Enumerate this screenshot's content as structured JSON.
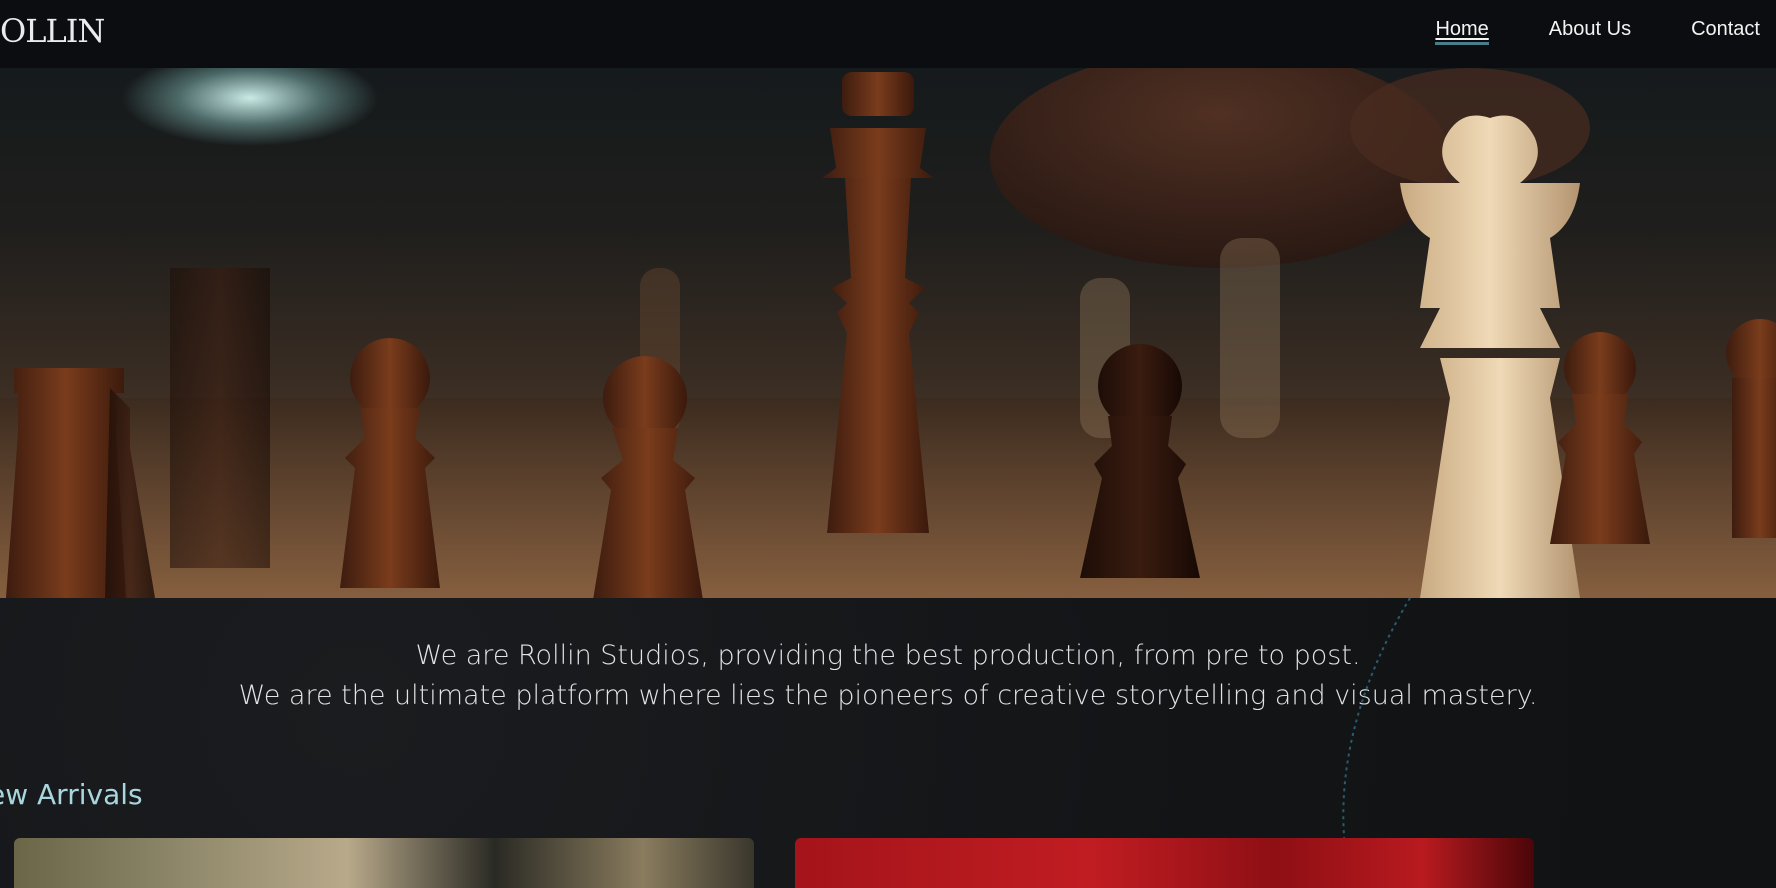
{
  "header": {
    "logo_text": "OLLIN",
    "nav": [
      {
        "label": "Home",
        "active": true
      },
      {
        "label": "About Us",
        "active": false
      },
      {
        "label": "Contact",
        "active": false
      }
    ]
  },
  "hero": {
    "image_subject": "chess-pieces-photo"
  },
  "intro": {
    "line1": "We are Rollin Studios, providing the best production, from pre to post.",
    "line2": "We are the ultimate platform where lies the pioneers of creative storytelling and visual mastery."
  },
  "new_arrivals": {
    "title": "ew Arrivals",
    "cards": [
      {
        "image_subject": "movie-poster-1"
      },
      {
        "image_subject": "movie-poster-2"
      }
    ]
  },
  "colors": {
    "header_bg": "#0b0d10",
    "page_bg": "#111315",
    "accent": "#4a7d8a",
    "section_title": "#a9d6de"
  }
}
